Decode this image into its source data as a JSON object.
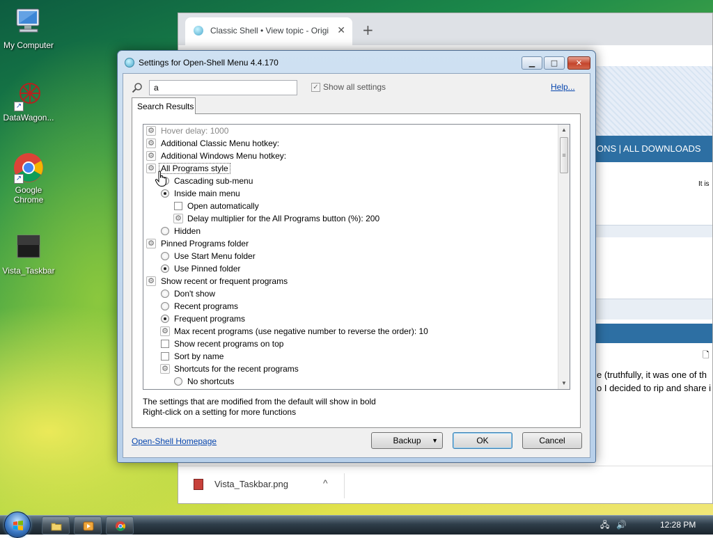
{
  "desktop": {
    "icons": [
      {
        "label": "My Computer"
      },
      {
        "label": "DataWagon..."
      },
      {
        "label": "Google Chrome"
      },
      {
        "label": "Vista_Taskbar"
      }
    ]
  },
  "browser": {
    "tab_title": "Classic Shell • View topic - Origi",
    "tab_close": "✕",
    "new_tab": "+",
    "site_nav": "ONS  |  ALL DOWNLOADS",
    "site_text_1": "It is",
    "site_text_2": "e (truthfully, it was one of th",
    "site_text_3": "o I decided to rip and share i",
    "download_file": "Vista_Taskbar.png",
    "download_chevron": "^"
  },
  "dialog": {
    "title": "Settings for Open-Shell Menu 4.4.170",
    "caption": {
      "minimize": "▁",
      "maximize": "□",
      "close": "✕"
    },
    "search_value": "a",
    "show_all_label": "Show all settings",
    "show_all_mark": "✓",
    "help_label": "Help...",
    "tab_label": "Search Results",
    "tree_items": [
      {
        "label": "Hover delay: 1000"
      },
      {
        "label": "Additional Classic Menu hotkey:"
      },
      {
        "label": "Additional Windows Menu hotkey:"
      },
      {
        "label": "All Programs style"
      },
      {
        "label": "Cascading sub-menu"
      },
      {
        "label": "Inside main menu"
      },
      {
        "label": "Open automatically"
      },
      {
        "label": "Delay multiplier for the All Programs button (%): 200"
      },
      {
        "label": "Hidden"
      },
      {
        "label": "Pinned Programs folder"
      },
      {
        "label": "Use Start Menu folder"
      },
      {
        "label": "Use Pinned folder"
      },
      {
        "label": "Show recent or frequent programs"
      },
      {
        "label": "Don't show"
      },
      {
        "label": "Recent programs"
      },
      {
        "label": "Frequent programs"
      },
      {
        "label": "Max recent programs (use negative number to reverse the order): 10"
      },
      {
        "label": "Show recent programs on top"
      },
      {
        "label": "Sort by name"
      },
      {
        "label": "Shortcuts for the recent programs"
      },
      {
        "label": "No shortcuts"
      }
    ],
    "hint_line_1": "The settings that are modified from the default will show in bold",
    "hint_line_2": "Right-click on a setting for more functions",
    "homepage_link": "Open-Shell Homepage",
    "backup_label": "Backup",
    "ok_label": "OK",
    "cancel_label": "Cancel"
  },
  "taskbar": {
    "clock": "12:28 PM"
  }
}
